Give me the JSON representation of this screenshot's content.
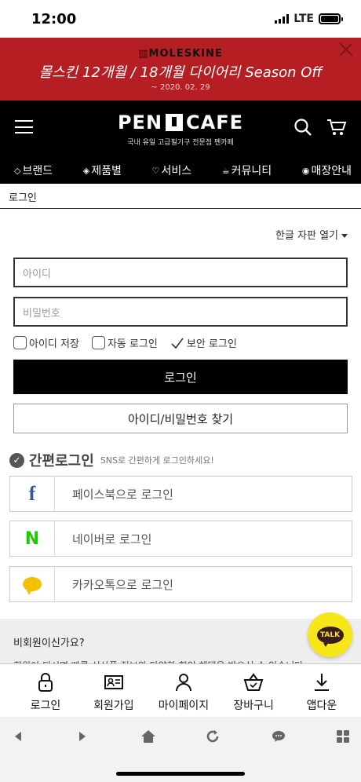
{
  "status_bar": {
    "time": "12:00",
    "network": "LTE"
  },
  "banner": {
    "brand": "▥MOLESKINE",
    "title": "몰스킨 12개월 / 18개월 다이어리 Season Off",
    "date": "~ 2020. 02. 29"
  },
  "header": {
    "logo": "PEN",
    "logo_second": "CAFE",
    "subtitle": "국내 유일 고급필기구 전문점 펜카페",
    "icons": {
      "menu": "hamburger-icon",
      "search": "search-icon",
      "cart": "cart-icon"
    }
  },
  "nav": {
    "items": [
      {
        "label": "브랜드",
        "icon": "tag-icon"
      },
      {
        "label": "제품별",
        "icon": "pen-nib-icon"
      },
      {
        "label": "서비스",
        "icon": "heart-icon"
      },
      {
        "label": "커뮤니티",
        "icon": "cup-icon"
      },
      {
        "label": "매장안내",
        "icon": "location-pin-icon"
      }
    ]
  },
  "breadcrumb": "로그인",
  "keyboard_link": "한글 자판 열기",
  "form": {
    "id_placeholder": "아이디",
    "password_placeholder": "비밀번호",
    "save_id_label": "아이디 저장",
    "auto_login_label": "자동 로그인",
    "secure_login_label": "보안 로그인",
    "login_button": "로그인",
    "find_button": "아이디/비밀번호 찾기"
  },
  "easy_login": {
    "title": "간편로그인",
    "subtitle": "SNS로 간편하게 로그인하세요!",
    "facebook": "페이스북으로 로그인",
    "naver": "네이버로 로그인",
    "kakao": "카카오톡으로 로그인"
  },
  "guest": {
    "title": "비회원이신가요?",
    "text": "회원이 되시면 빠른 신상품 정보와 다양한 할인 혜택을 받으실 수 있습니다."
  },
  "talk_button": "TALK",
  "bottom_nav": [
    {
      "label": "로그인",
      "icon": "lock-icon"
    },
    {
      "label": "회원가입",
      "icon": "id-card-icon"
    },
    {
      "label": "마이페이지",
      "icon": "person-icon"
    },
    {
      "label": "장바구니",
      "icon": "basket-icon"
    },
    {
      "label": "앱다운",
      "icon": "download-icon"
    }
  ],
  "browser_bar": {
    "icons": [
      "back-icon",
      "forward-icon",
      "home-icon",
      "refresh-icon",
      "chat-icon",
      "grid-icon"
    ]
  },
  "colors": {
    "banner": "#b51f24",
    "header": "#000000",
    "facebook": "#3b5998",
    "naver": "#1ec800",
    "kakao": "#f2c200",
    "talk": "#f7e61a"
  }
}
